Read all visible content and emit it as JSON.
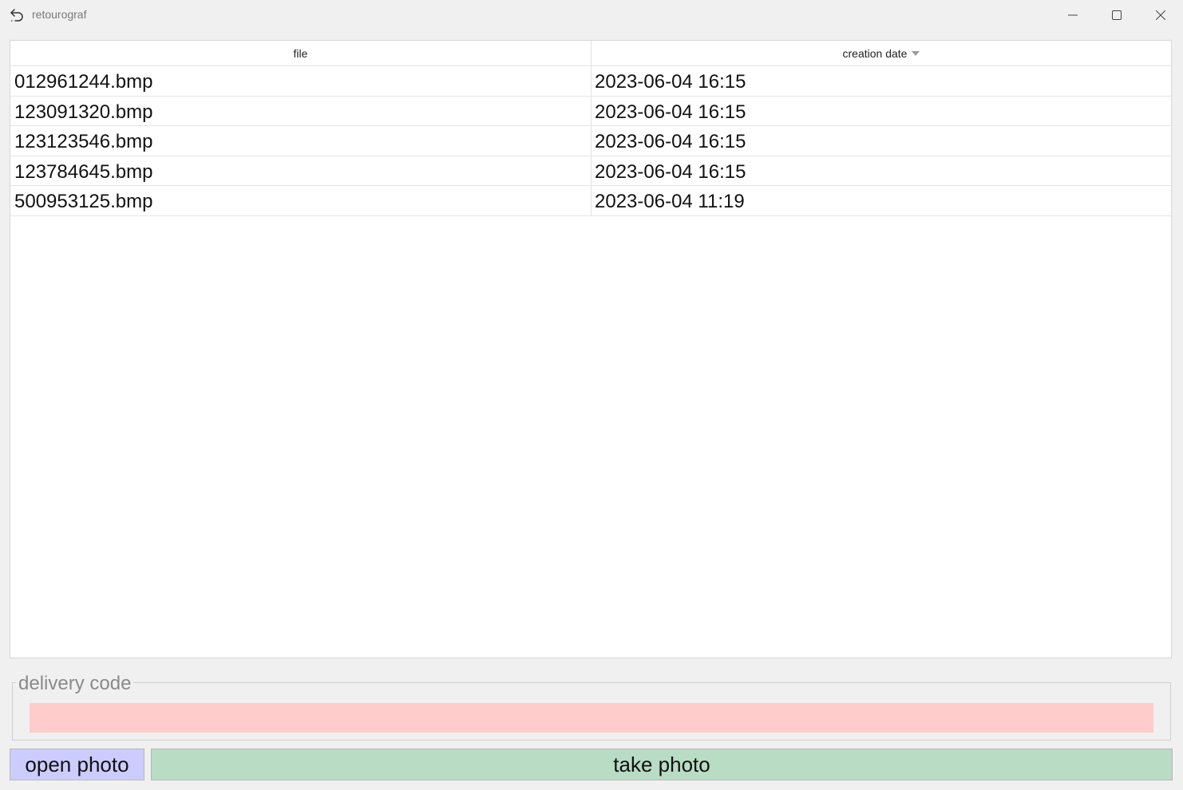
{
  "window": {
    "title": "retourograf",
    "icon": "back-arrow-icon"
  },
  "table": {
    "columns": [
      {
        "label": "file"
      },
      {
        "label": "creation date",
        "sort": "descending"
      }
    ],
    "rows": [
      {
        "file": "012961244.bmp",
        "date": "2023-06-04 16:15"
      },
      {
        "file": "123091320.bmp",
        "date": "2023-06-04 16:15"
      },
      {
        "file": "123123546.bmp",
        "date": "2023-06-04 16:15"
      },
      {
        "file": "123784645.bmp",
        "date": "2023-06-04 16:15"
      },
      {
        "file": "500953125.bmp",
        "date": "2023-06-04 11:19"
      }
    ]
  },
  "delivery": {
    "legend": "delivery code",
    "value": "",
    "input_color": "#ffcccc"
  },
  "buttons": {
    "open_photo": "open photo",
    "take_photo": "take photo",
    "open_color": "#ccccff",
    "take_color": "#b8dcc4"
  }
}
